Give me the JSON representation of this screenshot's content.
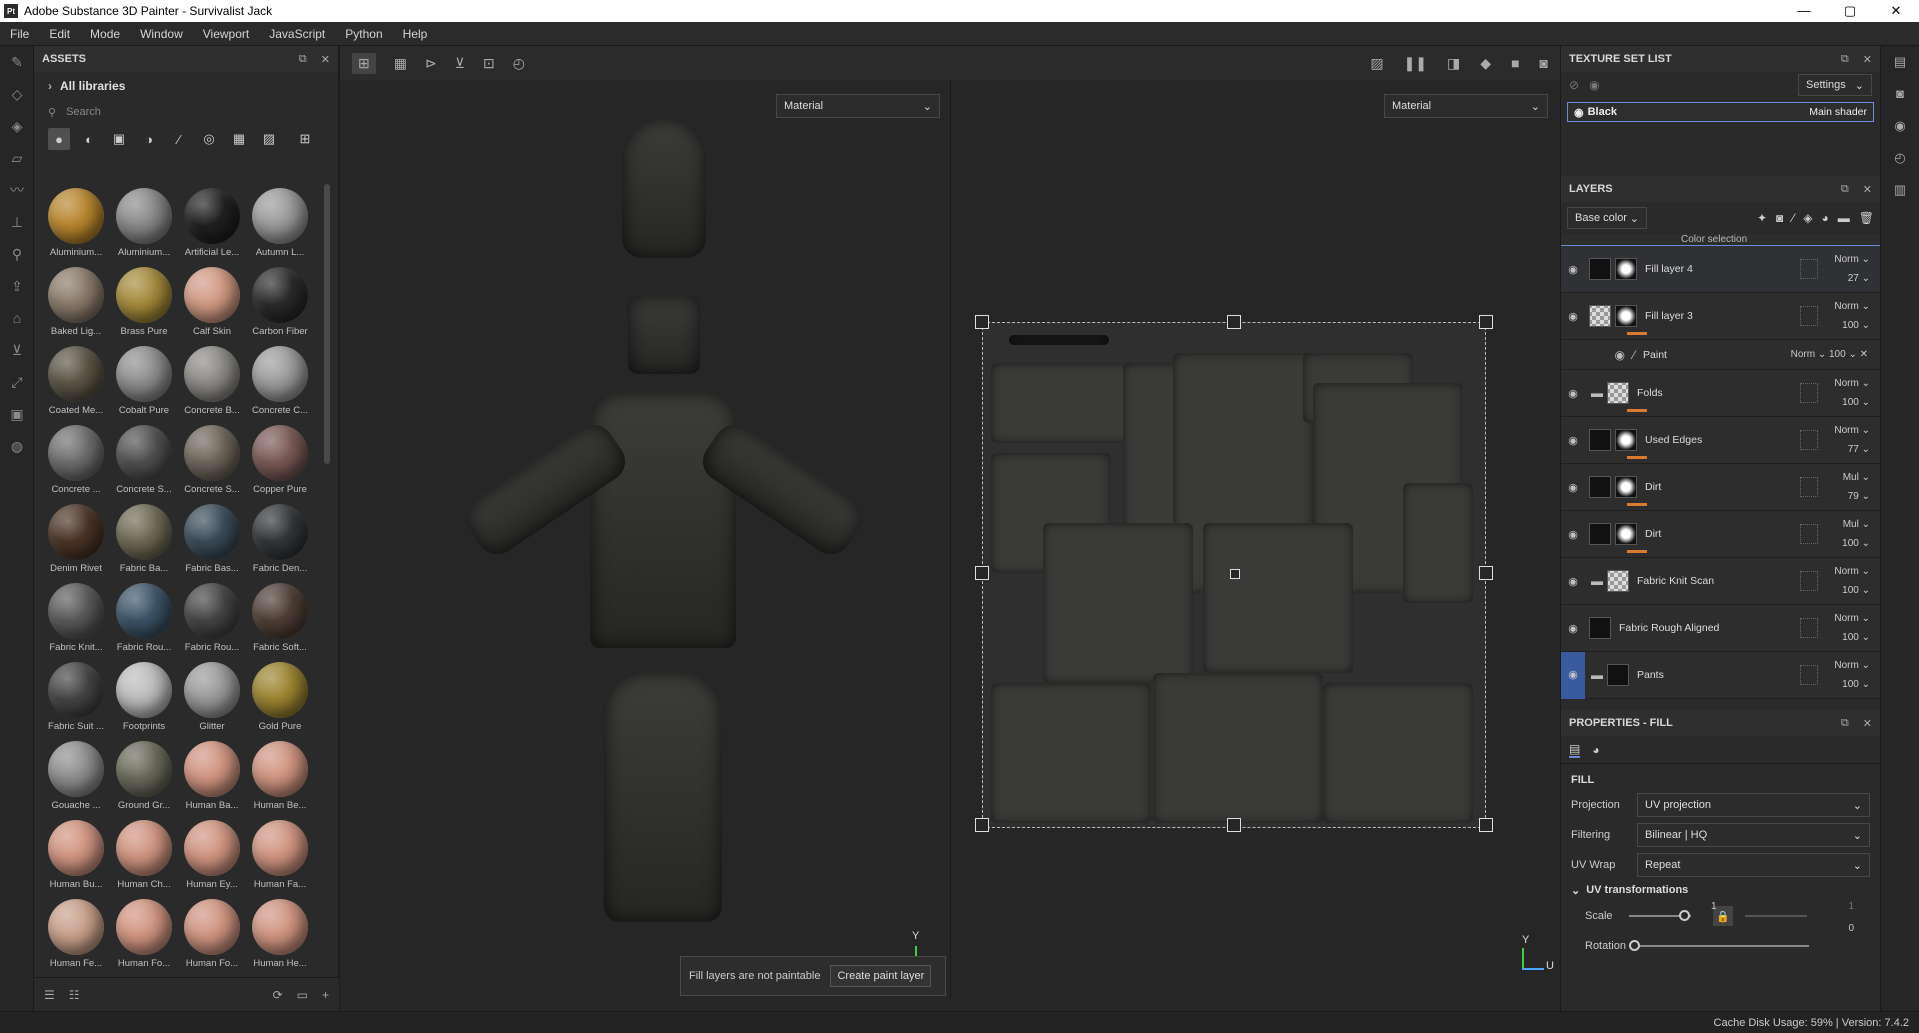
{
  "app": {
    "title": "Adobe Substance 3D Painter - Survivalist Jack",
    "logo": "Pt"
  },
  "window_controls": {
    "minimize": "—",
    "maximize": "▢",
    "close": "✕"
  },
  "menu": [
    "File",
    "Edit",
    "Mode",
    "Window",
    "Viewport",
    "JavaScript",
    "Python",
    "Help"
  ],
  "assets": {
    "title": "ASSETS",
    "libraries": "All libraries",
    "search_placeholder": "Search",
    "items": [
      {
        "label": "Aluminium...",
        "color": "#b8862e"
      },
      {
        "label": "Aluminium...",
        "color": "#8a8a8a"
      },
      {
        "label": "Artificial Le...",
        "color": "#202020"
      },
      {
        "label": "Autumn L...",
        "color": "#9a9a9a"
      },
      {
        "label": "Baked Lig...",
        "color": "#8a7a6a"
      },
      {
        "label": "Brass Pure",
        "color": "#a48a3a"
      },
      {
        "label": "Calf Skin",
        "color": "#d29a84"
      },
      {
        "label": "Carbon Fiber",
        "color": "#2a2a2a"
      },
      {
        "label": "Coated Me...",
        "color": "#5a5444"
      },
      {
        "label": "Cobalt Pure",
        "color": "#8e8e90"
      },
      {
        "label": "Concrete B...",
        "color": "#8c8a86"
      },
      {
        "label": "Concrete C...",
        "color": "#9c9c9c"
      },
      {
        "label": "Concrete ...",
        "color": "#6e6e6e"
      },
      {
        "label": "Concrete S...",
        "color": "#505050"
      },
      {
        "label": "Concrete S...",
        "color": "#6e665a"
      },
      {
        "label": "Copper Pure",
        "color": "#7a5a55"
      },
      {
        "label": "Denim Rivet",
        "color": "#4a3426"
      },
      {
        "label": "Fabric Ba...",
        "color": "#6e6a54"
      },
      {
        "label": "Fabric Bas...",
        "color": "#3a4c5a"
      },
      {
        "label": "Fabric Den...",
        "color": "#323638"
      },
      {
        "label": "Fabric Knit...",
        "color": "#5a5a5a"
      },
      {
        "label": "Fabric Rou...",
        "color": "#3c5468"
      },
      {
        "label": "Fabric Rou...",
        "color": "#444444"
      },
      {
        "label": "Fabric Soft...",
        "color": "#4e3e34"
      },
      {
        "label": "Fabric Suit ...",
        "color": "#444444"
      },
      {
        "label": "Footprints",
        "color": "#bcbcbc"
      },
      {
        "label": "Glitter",
        "color": "#9a9a9a"
      },
      {
        "label": "Gold Pure",
        "color": "#9c8430"
      },
      {
        "label": "Gouache ...",
        "color": "#8e8e8e"
      },
      {
        "label": "Ground Gr...",
        "color": "#6a6a5a"
      },
      {
        "label": "Human Ba...",
        "color": "#d09480"
      },
      {
        "label": "Human Be...",
        "color": "#d09480"
      },
      {
        "label": "Human Bu...",
        "color": "#d09480"
      },
      {
        "label": "Human Ch...",
        "color": "#d09480"
      },
      {
        "label": "Human Ey...",
        "color": "#d09480"
      },
      {
        "label": "Human Fa...",
        "color": "#d09480"
      },
      {
        "label": "Human Fe...",
        "color": "#c8a08a"
      },
      {
        "label": "Human Fo...",
        "color": "#d09480"
      },
      {
        "label": "Human Fo...",
        "color": "#d09480"
      },
      {
        "label": "Human He...",
        "color": "#d09480"
      }
    ]
  },
  "viewport": {
    "left_mode": "Material",
    "right_mode": "Material",
    "toast_text": "Fill layers are not paintable",
    "toast_button": "Create paint layer",
    "axis_y_left": "Y",
    "axis_y_right": "Y",
    "axis_u": "U"
  },
  "texture_set_list": {
    "title": "TEXTURE SET LIST",
    "settings": "Settings",
    "set_name": "Black",
    "shader": "Main shader"
  },
  "layers": {
    "title": "LAYERS",
    "channel": "Base color",
    "partial_top": "Color selection",
    "items": [
      {
        "name": "Fill layer 4",
        "blend": "Norm",
        "opacity": "27",
        "thumb": "dark",
        "selected": true,
        "bar": false
      },
      {
        "name": "Fill layer 3",
        "blend": "Norm",
        "opacity": "100",
        "thumb": "check",
        "selected": false,
        "bar": true
      },
      {
        "name": "Folds",
        "blend": "Norm",
        "opacity": "100",
        "thumb": "check",
        "selected": false,
        "bar": true
      },
      {
        "name": "Used Edges",
        "blend": "Norm",
        "opacity": "77",
        "thumb": "dark",
        "selected": false,
        "bar": true
      },
      {
        "name": "Dirt",
        "blend": "Mul",
        "opacity": "79",
        "thumb": "dark",
        "selected": false,
        "bar": true
      },
      {
        "name": "Dirt",
        "blend": "Mul",
        "opacity": "100",
        "thumb": "dark",
        "selected": false,
        "bar": true
      },
      {
        "name": "Fabric Knit Scan",
        "blend": "Norm",
        "opacity": "100",
        "thumb": "check",
        "selected": false,
        "bar": false
      },
      {
        "name": "Fabric Rough Aligned",
        "blend": "Norm",
        "opacity": "100",
        "thumb": "dark",
        "selected": false,
        "bar": false
      },
      {
        "name": "Pants",
        "blend": "Norm",
        "opacity": "100",
        "thumb": "dark",
        "selected": false,
        "bar": false
      }
    ],
    "sublayer": {
      "name": "Paint",
      "blend": "Norm",
      "opacity": "100"
    }
  },
  "properties": {
    "title": "PROPERTIES - FILL",
    "section": "FILL",
    "projection_label": "Projection",
    "projection_value": "UV projection",
    "filtering_label": "Filtering",
    "filtering_value": "Bilinear | HQ",
    "uvwrap_label": "UV Wrap",
    "uvwrap_value": "Repeat",
    "uvt_title": "UV transformations",
    "scale_label": "Scale",
    "scale_value": "1",
    "scale_value2": "1",
    "rotation_label": "Rotation",
    "rotation_value": "0"
  },
  "status": {
    "text": "Cache Disk Usage:    59% | Version: 7.4.2"
  }
}
